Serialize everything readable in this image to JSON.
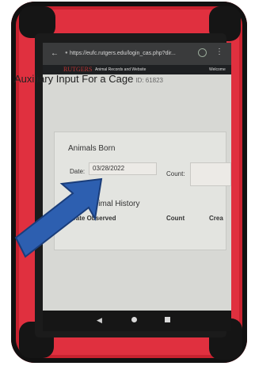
{
  "browser": {
    "url": "https://eufc.rutgers.edu/login_cas.php?dir..."
  },
  "site_nav": {
    "logo": "RUTGERS",
    "link1": "Animal Records and Website",
    "link2": "Welcome"
  },
  "page": {
    "title": "Auxiliary Input For a Cage",
    "id_label": "ID: 61823"
  },
  "animals_born": {
    "heading": "Animals Born",
    "date_label": "Date:",
    "date_value": "03/28/2022",
    "count_label": "Count:"
  },
  "animal_history": {
    "heading": "Animal History",
    "columns": [
      "Date Observed",
      "Count",
      "Crea"
    ]
  },
  "colors": {
    "case": "#e0303f",
    "arrow": "#2d5fb0",
    "screen_bg": "#d7d8d4"
  }
}
